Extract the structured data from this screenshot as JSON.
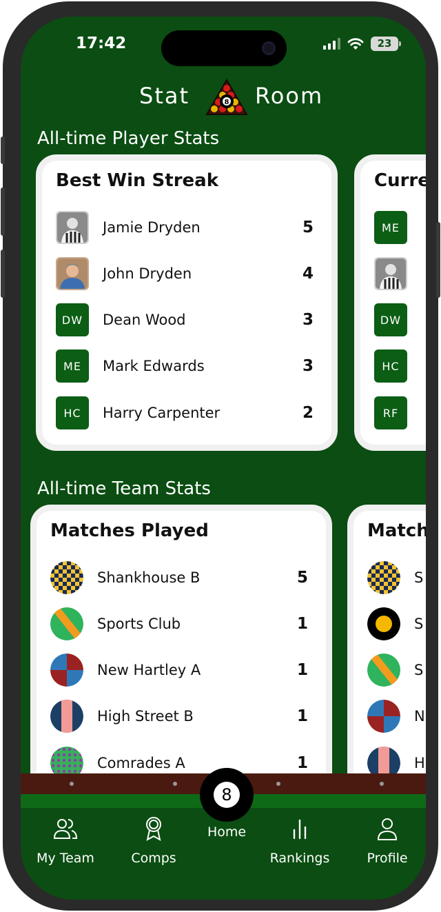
{
  "status_bar": {
    "time": "17:42",
    "battery": "23"
  },
  "header": {
    "logo_left": "Stat",
    "logo_right": "Room",
    "logo_ball": "8"
  },
  "player_stats": {
    "section_title": "All-time Player Stats",
    "cards": [
      {
        "title": "Best Win Streak",
        "rows": [
          {
            "name": "Jamie Dryden",
            "value": "5",
            "avatar": "photo-bw"
          },
          {
            "name": "John Dryden",
            "value": "4",
            "avatar": "photo-color"
          },
          {
            "name": "Dean Wood",
            "value": "3",
            "initials": "DW"
          },
          {
            "name": "Mark Edwards",
            "value": "3",
            "initials": "ME"
          },
          {
            "name": "Harry Carpenter",
            "value": "2",
            "initials": "HC"
          }
        ]
      },
      {
        "title": "Curre",
        "rows": [
          {
            "initials": "ME"
          },
          {
            "avatar": "photo-bw"
          },
          {
            "initials": "DW"
          },
          {
            "initials": "HC"
          },
          {
            "initials": "RF"
          }
        ]
      }
    ]
  },
  "team_stats": {
    "section_title": "All-time Team Stats",
    "cards": [
      {
        "title": "Matches Played",
        "rows": [
          {
            "name": "Shankhouse B",
            "value": "5",
            "badge": "checker-navy-yellow"
          },
          {
            "name": "Sports Club",
            "value": "1",
            "badge": "diagonal-green-orange"
          },
          {
            "name": "New Hartley A",
            "value": "1",
            "badge": "quarters-blue-red"
          },
          {
            "name": "High Street B",
            "value": "1",
            "badge": "stripe-navy-pink"
          },
          {
            "name": "Comrades A",
            "value": "1",
            "badge": "dots-green-purple"
          }
        ]
      },
      {
        "title": "Match",
        "rows": [
          {
            "partial": "S",
            "badge": "checker-navy-yellow"
          },
          {
            "partial": "S",
            "badge": "ring-black-yellow"
          },
          {
            "partial": "S",
            "badge": "diagonal-green-orange"
          },
          {
            "partial": "N",
            "badge": "quarters-blue-red"
          },
          {
            "partial": "H",
            "badge": "stripe-navy-pink"
          }
        ]
      }
    ]
  },
  "nav": {
    "items": [
      {
        "label": "My Team",
        "icon": "people-icon"
      },
      {
        "label": "Comps",
        "icon": "award-icon"
      },
      {
        "label": "Home",
        "icon": "eight-ball-icon"
      },
      {
        "label": "Rankings",
        "icon": "bar-chart-icon"
      },
      {
        "label": "Profile",
        "icon": "person-icon"
      }
    ],
    "home_ball": "8"
  },
  "colors": {
    "background": "#0b4d12",
    "card": "#ffffff",
    "initials_tile": "#0b5e14",
    "rail": "#4a1a10"
  }
}
